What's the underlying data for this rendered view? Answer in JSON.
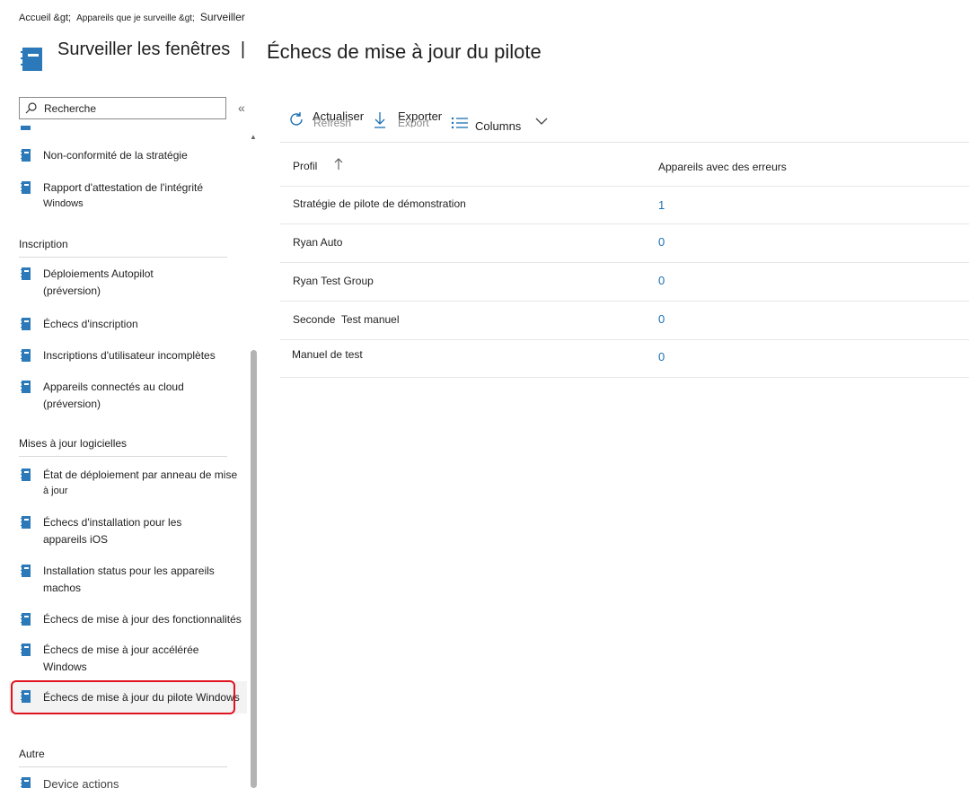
{
  "breadcrumb": {
    "home": "Accueil &gt;",
    "devices": "Appareils que je surveille &gt;",
    "current": "Surveiller"
  },
  "header": {
    "title_left": "Surveiller les fenêtres",
    "separator": "|",
    "title_right": "Échecs de mise à jour du pilote"
  },
  "search": {
    "placeholder": "Recherche"
  },
  "sidebar": {
    "items_top": [
      {
        "label": "Non-conformité de la stratégie"
      },
      {
        "label_line1": "Rapport d'attestation de l'intégrité",
        "label_line2": "Windows"
      }
    ],
    "sections": [
      {
        "title": "Inscription",
        "items": [
          {
            "label_line1": "Déploiements Autopilot",
            "label_line2": "(préversion)"
          },
          {
            "label": "Échecs d'inscription"
          },
          {
            "label": "Inscriptions d'utilisateur incomplètes"
          },
          {
            "label_line1": "Appareils connectés au cloud",
            "label_line2": "(préversion)"
          }
        ]
      },
      {
        "title": "Mises à jour logicielles",
        "items": [
          {
            "label_line1": "État de déploiement par anneau de mise",
            "label_line2": "à jour"
          },
          {
            "label_line1": "Échecs d'installation pour les",
            "label_line2": "appareils iOS"
          },
          {
            "label_line1": "Installation status pour les appareils",
            "label_line2": "machos"
          },
          {
            "label": "Échecs de mise à jour des fonctionnalités"
          },
          {
            "label_line1": "Échecs de mise à jour accélérée",
            "label_line2": "Windows"
          },
          {
            "label": "Échecs de mise à jour du pilote Windows",
            "selected": true
          }
        ]
      },
      {
        "title": "Autre",
        "items": [
          {
            "label": "Device actions"
          }
        ]
      }
    ]
  },
  "toolbar": {
    "refresh_label": "Actualiser",
    "refresh_ghost": "Refresh",
    "export_label": "Exporter",
    "export_ghost": "Export",
    "columns_label": "Columns"
  },
  "table": {
    "headers": {
      "profile": "Profil",
      "devices_with_errors": "Appareils avec des erreurs"
    },
    "rows": [
      {
        "name": "Stratégie de pilote de démonstration",
        "count": "1"
      },
      {
        "name": "Ryan Auto",
        "count": "0"
      },
      {
        "name": "Ryan Test Group",
        "count": "0"
      },
      {
        "name": "Seconde  Test manuel",
        "count": "0"
      },
      {
        "name": "Manuel de test",
        "count": "0"
      }
    ]
  },
  "colors": {
    "accent": "#1a6fb3",
    "selection_outline": "#e0141e",
    "icon": "#2b79b8"
  }
}
